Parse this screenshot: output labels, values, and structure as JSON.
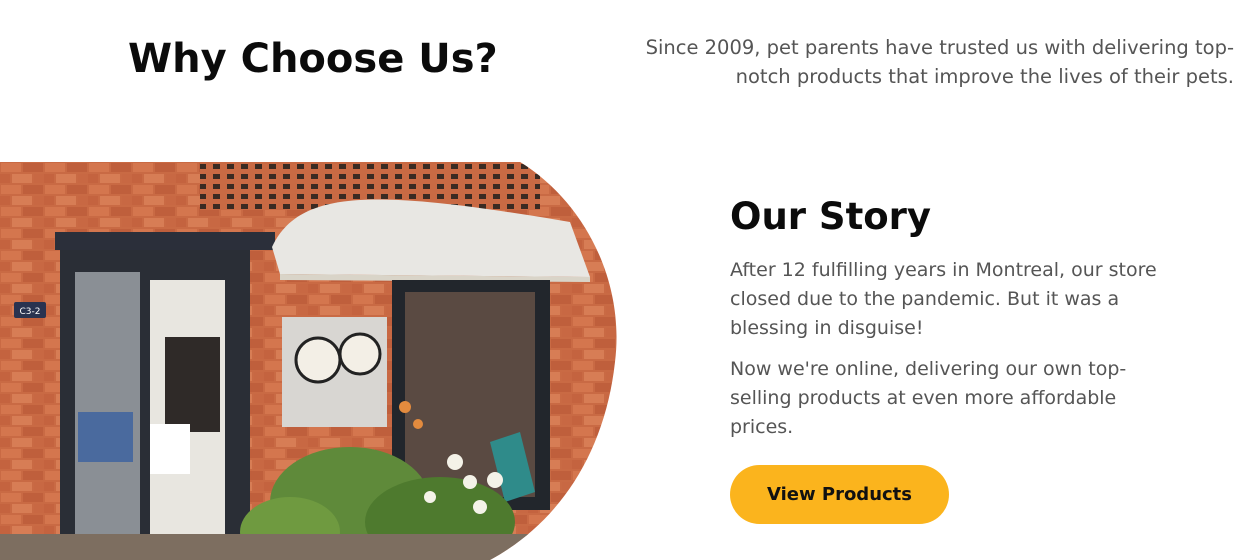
{
  "why": {
    "title": "Why Choose Us?",
    "text": "Since 2009, pet parents have trusted us with delivering top-notch products that improve the lives of their pets."
  },
  "story": {
    "title": "Our Story",
    "paragraph1": "After 12 fulfilling years in Montreal, our store closed due to the pandemic. But it was a blessing in disguise!",
    "paragraph2": "Now we're online, delivering our own top-selling products at even more affordable prices.",
    "button_label": "View Products"
  },
  "photo": {
    "address_plate": "C3-2"
  },
  "colors": {
    "accent": "#fbb41d",
    "brick": "#c8643f",
    "text_muted": "#555555"
  }
}
